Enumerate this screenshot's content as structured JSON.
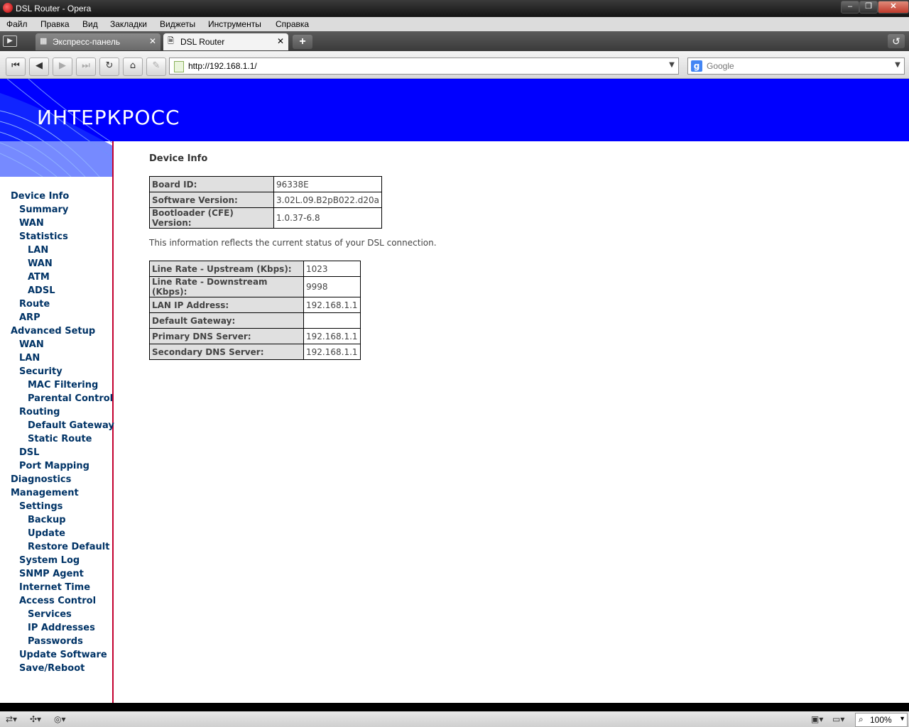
{
  "window": {
    "title": "DSL Router - Opera",
    "minimize": "–",
    "maximize": "❐",
    "close": "✕"
  },
  "menu": {
    "items": [
      "Файл",
      "Правка",
      "Вид",
      "Закладки",
      "Виджеты",
      "Инструменты",
      "Справка"
    ]
  },
  "tabs": [
    {
      "label": "Экспресс-панель",
      "icon": "grid-icon",
      "active": false
    },
    {
      "label": "DSL Router",
      "icon": "page-icon",
      "active": true
    }
  ],
  "tab_controls": {
    "new_tab": "+",
    "closed_tabs_icon": "trash-icon"
  },
  "toolbar": {
    "icons": [
      "rewind-icon",
      "back-icon",
      "forward-icon",
      "fast-forward-icon",
      "reload-icon",
      "home-icon",
      "wand-icon"
    ],
    "address": "http://192.168.1.1/",
    "search_placeholder": "Google"
  },
  "banner": {
    "logo": "ИНТЕРКРОСС",
    "background_color": "#0000ff"
  },
  "sidebar": {
    "items": [
      {
        "label": "Device Info",
        "level": 0
      },
      {
        "label": "Summary",
        "level": 1
      },
      {
        "label": "WAN",
        "level": 1
      },
      {
        "label": "Statistics",
        "level": 1
      },
      {
        "label": "LAN",
        "level": 2
      },
      {
        "label": "WAN",
        "level": 2
      },
      {
        "label": "ATM",
        "level": 2
      },
      {
        "label": "ADSL",
        "level": 2
      },
      {
        "label": "Route",
        "level": 1
      },
      {
        "label": "ARP",
        "level": 1
      },
      {
        "label": "Advanced Setup",
        "level": 0
      },
      {
        "label": "WAN",
        "level": 1
      },
      {
        "label": "LAN",
        "level": 1
      },
      {
        "label": "Security",
        "level": 1
      },
      {
        "label": "MAC Filtering",
        "level": 2
      },
      {
        "label": "Parental Control",
        "level": 2
      },
      {
        "label": "Routing",
        "level": 1
      },
      {
        "label": "Default Gateway",
        "level": 2
      },
      {
        "label": "Static Route",
        "level": 2
      },
      {
        "label": "DSL",
        "level": 1
      },
      {
        "label": "Port Mapping",
        "level": 1
      },
      {
        "label": "Diagnostics",
        "level": 0
      },
      {
        "label": "Management",
        "level": 0
      },
      {
        "label": "Settings",
        "level": 1
      },
      {
        "label": "Backup",
        "level": 2
      },
      {
        "label": "Update",
        "level": 2
      },
      {
        "label": "Restore Default",
        "level": 2
      },
      {
        "label": "System Log",
        "level": 1
      },
      {
        "label": "SNMP Agent",
        "level": 1
      },
      {
        "label": "Internet Time",
        "level": 1
      },
      {
        "label": "Access Control",
        "level": 1
      },
      {
        "label": "Services",
        "level": 2
      },
      {
        "label": "IP Addresses",
        "level": 2
      },
      {
        "label": "Passwords",
        "level": 2
      },
      {
        "label": "Update Software",
        "level": 1
      },
      {
        "label": "Save/Reboot",
        "level": 1
      }
    ]
  },
  "main": {
    "title": "Device Info",
    "device_table": [
      {
        "label": "Board ID:",
        "value": "96338E"
      },
      {
        "label": "Software Version:",
        "value": "3.02L.09.B2pB022.d20a"
      },
      {
        "label": "Bootloader (CFE) Version:",
        "value": "1.0.37-6.8"
      }
    ],
    "note": "This information reflects the current status of your DSL connection.",
    "connection_table": [
      {
        "label": "Line Rate - Upstream (Kbps):",
        "value": "1023"
      },
      {
        "label": "Line Rate - Downstream (Kbps):",
        "value": "9998"
      },
      {
        "label": "LAN IP Address:",
        "value": "192.168.1.1"
      },
      {
        "label": "Default Gateway:",
        "value": ""
      },
      {
        "label": "Primary DNS Server:",
        "value": "192.168.1.1"
      },
      {
        "label": "Secondary DNS Server:",
        "value": "192.168.1.1"
      }
    ]
  },
  "statusbar": {
    "zoom": "100%",
    "icons": [
      "sync-icon",
      "unite-icon",
      "turbo-icon",
      "image-mode-icon",
      "view-icon",
      "zoom-icon"
    ]
  }
}
